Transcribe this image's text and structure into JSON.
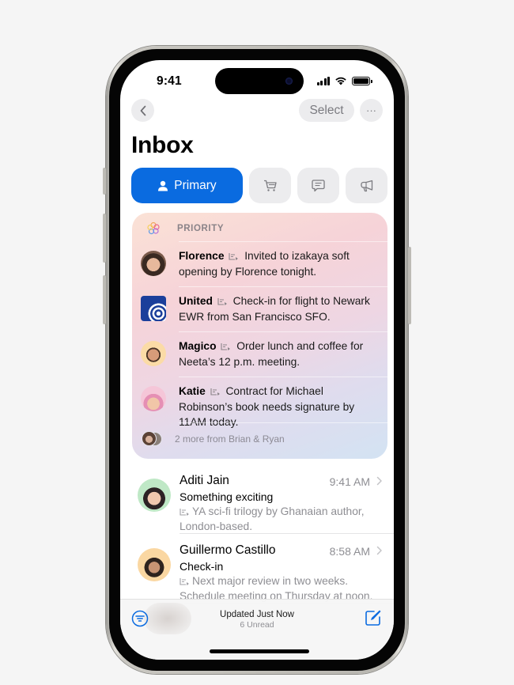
{
  "status_bar": {
    "time": "9:41",
    "battery_level": 1.0,
    "signal_bars": 4
  },
  "nav": {
    "back_icon": "chevron-left-icon",
    "select_label": "Select",
    "more_label": "···"
  },
  "header": {
    "title": "Inbox"
  },
  "tabs": [
    {
      "label": "Primary",
      "icon": "person-icon",
      "selected": true
    },
    {
      "label": "",
      "icon": "cart-icon",
      "selected": false
    },
    {
      "label": "",
      "icon": "message-icon",
      "selected": false
    },
    {
      "label": "",
      "icon": "megaphone-icon",
      "selected": false
    }
  ],
  "priority": {
    "label": "PRIORITY",
    "items": [
      {
        "sender": "Florence",
        "summary": "Invited to izakaya soft opening by Florence tonight."
      },
      {
        "sender": "United",
        "summary": "Check-in for flight to Newark EWR from San Francisco SFO."
      },
      {
        "sender": "Magico",
        "summary": "Order lunch and coffee for Neeta’s 12 p.m. meeting."
      },
      {
        "sender": "Katie",
        "summary": "Contract for Michael Robinson’s book needs signature by 11AM today."
      }
    ],
    "more": "2 more from Brian & Ryan"
  },
  "mails": [
    {
      "sender": "Aditi Jain",
      "time": "9:41 AM",
      "subject": "Something exciting",
      "preview": "YA sci-fi trilogy by Ghanaian author, London-based."
    },
    {
      "sender": "Guillermo Castillo",
      "time": "8:58 AM",
      "subject": "Check-in",
      "preview": "Next major review in two weeks. Schedule meeting on Thursday at noon."
    }
  ],
  "toolbar": {
    "status": "Updated Just Now",
    "unread": "6 Unread"
  },
  "colors": {
    "accent": "#0a6be0",
    "secondary_text": "#8e8e93",
    "chip_bg": "#ececee"
  }
}
